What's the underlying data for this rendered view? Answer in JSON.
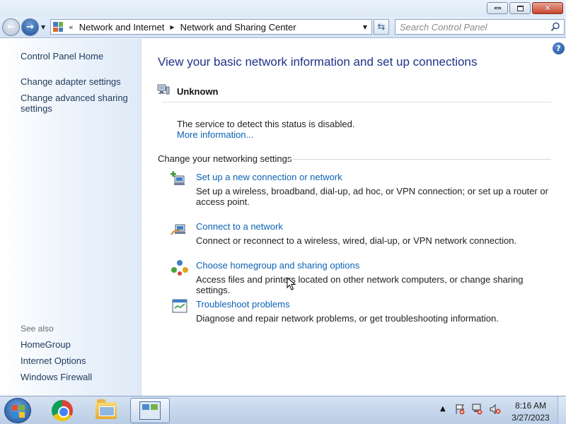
{
  "window": {
    "controls": [
      "minimize",
      "maximize",
      "close"
    ]
  },
  "navigation": {
    "breadcrumb_overflow": "«",
    "breadcrumbs": [
      "Network and Internet",
      "Network and Sharing Center"
    ],
    "search_placeholder": "Search Control Panel"
  },
  "sidebar": {
    "links": [
      "Control Panel Home",
      "Change adapter settings",
      "Change advanced sharing settings"
    ],
    "see_also_label": "See also",
    "see_also": [
      "HomeGroup",
      "Internet Options",
      "Windows Firewall"
    ]
  },
  "main": {
    "title": "View your basic network information and set up connections",
    "network_name": "Unknown",
    "status_text": "The service to detect this status is disabled.",
    "more_info": "More information...",
    "section_heading": "Change your networking settings",
    "tasks": [
      {
        "title": "Set up a new connection or network",
        "description": "Set up a wireless, broadband, dial-up, ad hoc, or VPN connection; or set up a router or access point.",
        "icon": "new-connection-icon"
      },
      {
        "title": "Connect to a network",
        "description": "Connect or reconnect to a wireless, wired, dial-up, or VPN network connection.",
        "icon": "connect-network-icon"
      },
      {
        "title": "Choose homegroup and sharing options",
        "description": "Access files and printers located on other network computers, or change sharing settings.",
        "icon": "homegroup-icon"
      },
      {
        "title": "Troubleshoot problems",
        "description": "Diagnose and repair network problems, or get troubleshooting information.",
        "icon": "troubleshoot-icon"
      }
    ]
  },
  "taskbar": {
    "apps": [
      "chrome-icon",
      "windows-explorer-icon",
      "control-panel-icon"
    ],
    "active_app": "control-panel-icon",
    "tray_icons": [
      "action-center-icon",
      "network-icon",
      "volume-muted-icon"
    ],
    "time": "8:16 AM",
    "date": "3/27/2023"
  },
  "colors": {
    "link": "#0c62b5",
    "title": "#1e3287",
    "sidebar_link": "#1e395b"
  }
}
